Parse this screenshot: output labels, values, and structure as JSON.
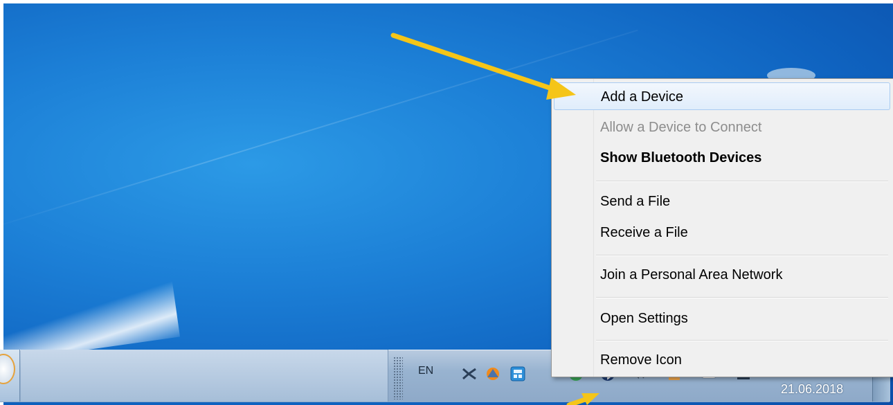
{
  "context_menu": {
    "items": [
      {
        "label": "Add a Device",
        "state": "hover"
      },
      {
        "label": "Allow a Device to Connect",
        "state": "disabled"
      },
      {
        "label": "Show Bluetooth Devices",
        "state": "default-bold"
      },
      {
        "label": "Send a File",
        "state": "normal"
      },
      {
        "label": "Receive a File",
        "state": "normal"
      },
      {
        "label": "Join a Personal Area Network",
        "state": "normal"
      },
      {
        "label": "Open Settings",
        "state": "normal"
      },
      {
        "label": "Remove Icon",
        "state": "normal"
      }
    ]
  },
  "taskbar": {
    "language": "EN",
    "clock_date": "21.06.2018",
    "tray_icons": [
      "network-app-icon",
      "shield-app-icon",
      "calculator-app-icon",
      "chrome-icon",
      "bluetooth-icon",
      "volume-icon",
      "vlc-icon",
      "cloud-icon",
      "network-status-icon"
    ]
  },
  "colors": {
    "highlight_arrow": "#f5c518",
    "desktop_blue": "#1c7fd6",
    "menu_background": "#f0f0f0"
  }
}
